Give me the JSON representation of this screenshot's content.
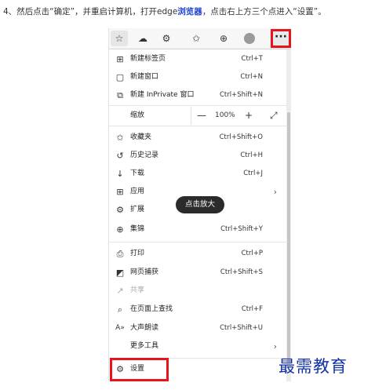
{
  "instruction": {
    "prefix": "4、然后点击“确定”，并重启计算机，打开edge",
    "link": "浏览器",
    "suffix": "，点击右上方三个点进入“设置”。"
  },
  "toolbar": {
    "more_label": "···"
  },
  "menu": {
    "items": [
      {
        "label": "新建标签页",
        "shortcut": "Ctrl+T",
        "icon": "new-tab-icon",
        "glyph": "⊞"
      },
      {
        "label": "新建窗口",
        "shortcut": "Ctrl+N",
        "icon": "new-window-icon",
        "glyph": "▢"
      },
      {
        "label": "新建 InPrivate 窗口",
        "shortcut": "Ctrl+Shift+N",
        "icon": "inprivate-icon",
        "glyph": "⧉"
      },
      {
        "label": "收藏夹",
        "shortcut": "Ctrl+Shift+O",
        "icon": "favorites-icon",
        "glyph": "✩"
      },
      {
        "label": "历史记录",
        "shortcut": "Ctrl+H",
        "icon": "history-icon",
        "glyph": "↺"
      },
      {
        "label": "下载",
        "shortcut": "Ctrl+J",
        "icon": "download-icon",
        "glyph": "↓"
      },
      {
        "label": "应用",
        "shortcut": "",
        "icon": "apps-icon",
        "glyph": "⊞"
      },
      {
        "label": "扩展",
        "shortcut": "",
        "icon": "extensions-icon",
        "glyph": "⚙"
      },
      {
        "label": "集锦",
        "shortcut": "Ctrl+Shift+Y",
        "icon": "collections-icon",
        "glyph": "⊕"
      },
      {
        "label": "打印",
        "shortcut": "Ctrl+P",
        "icon": "print-icon",
        "glyph": "⎙"
      },
      {
        "label": "网页捕获",
        "shortcut": "Ctrl+Shift+S",
        "icon": "web-capture-icon",
        "glyph": "◩"
      },
      {
        "label": "共享",
        "shortcut": "",
        "icon": "share-icon",
        "glyph": "↗"
      },
      {
        "label": "在页面上查找",
        "shortcut": "Ctrl+F",
        "icon": "find-icon",
        "glyph": "⌕"
      },
      {
        "label": "大声朗读",
        "shortcut": "Ctrl+Shift+U",
        "icon": "read-aloud-icon",
        "glyph": "A»"
      },
      {
        "label": "更多工具",
        "shortcut": "",
        "icon": "more-tools-icon",
        "glyph": ""
      },
      {
        "label": "设置",
        "shortcut": "",
        "icon": "settings-icon",
        "glyph": "⚙"
      }
    ],
    "zoom": {
      "label": "缩放",
      "value": "100%",
      "minus": "—",
      "plus": "+",
      "fullscreen": "⤢"
    }
  },
  "tooltip": "点击放大",
  "watermark": "最需教育",
  "colors": {
    "highlight": "#e8131b",
    "link": "#1a3fd6",
    "watermark": "#1433a8"
  }
}
